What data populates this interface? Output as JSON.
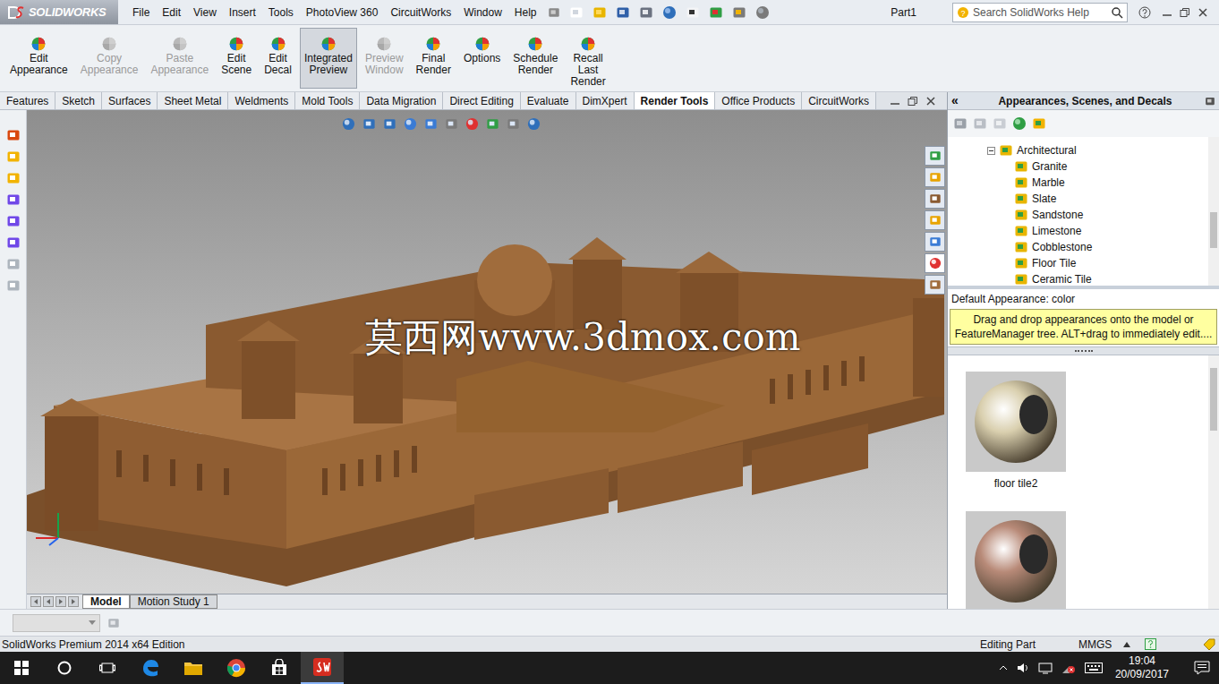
{
  "app": {
    "logo": "SOLIDWORKS",
    "document_title": "Part1"
  },
  "menu": [
    "File",
    "Edit",
    "View",
    "Insert",
    "Tools",
    "PhotoView 360",
    "CircuitWorks",
    "Window",
    "Help"
  ],
  "search": {
    "placeholder": "Search SolidWorks Help"
  },
  "ribbon": [
    {
      "label": "Edit\nAppearance",
      "disabled": false,
      "selected": false
    },
    {
      "label": "Copy\nAppearance",
      "disabled": true,
      "selected": false
    },
    {
      "label": "Paste\nAppearance",
      "disabled": true,
      "selected": false
    },
    {
      "label": "Edit\nScene",
      "disabled": false,
      "selected": false
    },
    {
      "label": "Edit\nDecal",
      "disabled": false,
      "selected": false
    },
    {
      "label": "Integrated\nPreview",
      "disabled": false,
      "selected": true
    },
    {
      "label": "Preview\nWindow",
      "disabled": true,
      "selected": false
    },
    {
      "label": "Final\nRender",
      "disabled": false,
      "selected": false
    },
    {
      "label": "Options",
      "disabled": false,
      "selected": false
    },
    {
      "label": "Schedule\nRender",
      "disabled": false,
      "selected": false
    },
    {
      "label": "Recall\nLast\nRender",
      "disabled": false,
      "selected": false
    }
  ],
  "tabs": [
    {
      "label": "Features",
      "selected": false
    },
    {
      "label": "Sketch",
      "selected": false
    },
    {
      "label": "Surfaces",
      "selected": false
    },
    {
      "label": "Sheet Metal",
      "selected": false
    },
    {
      "label": "Weldments",
      "selected": false
    },
    {
      "label": "Mold Tools",
      "selected": false
    },
    {
      "label": "Data Migration",
      "selected": false
    },
    {
      "label": "Direct Editing",
      "selected": false
    },
    {
      "label": "Evaluate",
      "selected": false
    },
    {
      "label": "DimXpert",
      "selected": false
    },
    {
      "label": "Render Tools",
      "selected": true
    },
    {
      "label": "Office Products",
      "selected": false
    },
    {
      "label": "CircuitWorks",
      "selected": false
    }
  ],
  "viewport": {
    "watermark": "莫西网www.3dmox.com"
  },
  "bottom_tabs": [
    {
      "label": "Model",
      "selected": true
    },
    {
      "label": "Motion Study 1",
      "selected": false
    }
  ],
  "panel": {
    "collapse_glyph": "«",
    "title": "Appearances, Scenes, and Decals",
    "tree_parent": {
      "label": "Architectural",
      "expanded": true
    },
    "tree_items": [
      "Granite",
      "Marble",
      "Slate",
      "Sandstone",
      "Limestone",
      "Cobblestone",
      "Floor Tile",
      "Ceramic Tile"
    ],
    "selection": "Default Appearance: color",
    "tip": "Drag and drop appearances onto the model or FeatureManager tree.  ALT+drag to immediately edit....",
    "thumbnails": [
      {
        "label": "floor tile2",
        "color": "#d9cfae"
      },
      {
        "label": "",
        "color": "#b88a78"
      }
    ]
  },
  "status_bar": {
    "edition": "SolidWorks Premium 2014 x64 Edition",
    "mode": "Editing Part",
    "units": "MMGS"
  },
  "taskbar": {
    "time": "19:04",
    "date": "20/09/2017"
  }
}
